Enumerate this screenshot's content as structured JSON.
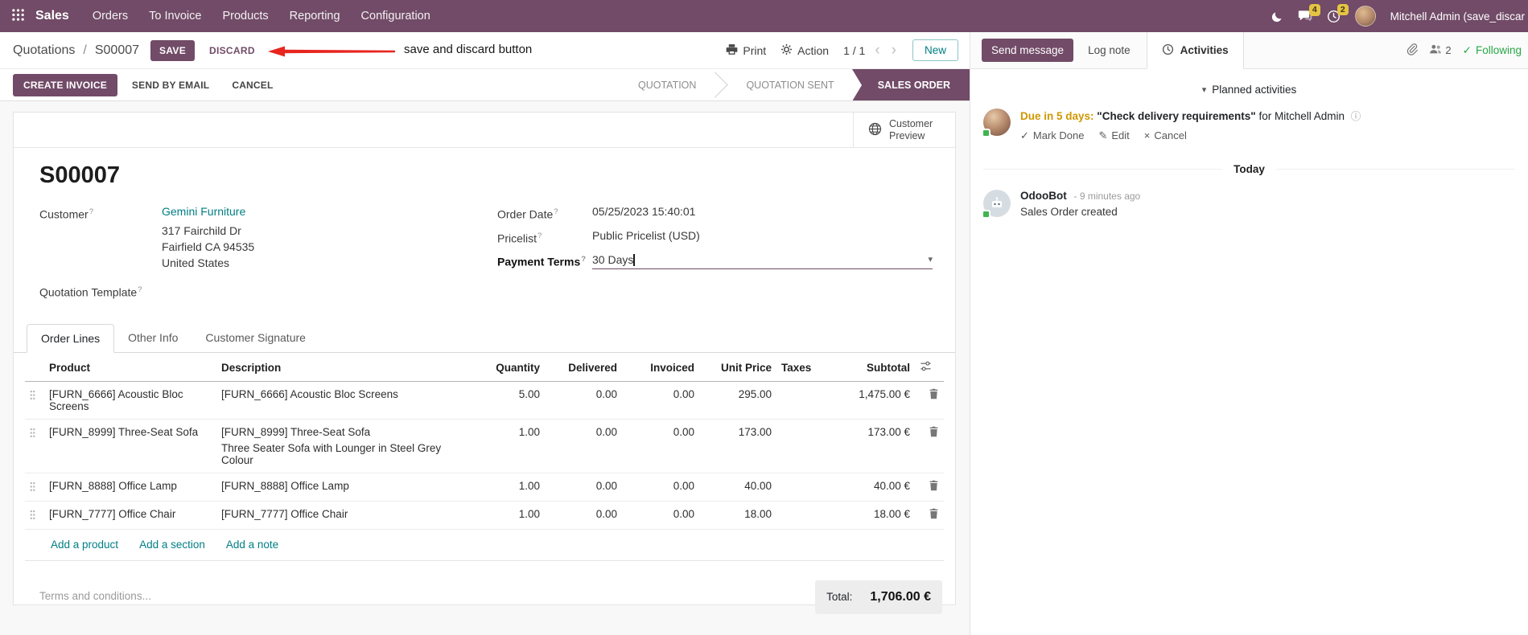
{
  "topbar": {
    "app_name": "Sales",
    "menus": [
      "Orders",
      "To Invoice",
      "Products",
      "Reporting",
      "Configuration"
    ],
    "messages_badge": "4",
    "activities_badge": "2",
    "user_name": "Mitchell Admin (save_discar"
  },
  "control_panel": {
    "breadcrumb_parent": "Quotations",
    "breadcrumb_sep": "/",
    "breadcrumb_current": "S00007",
    "save_label": "SAVE",
    "discard_label": "DISCARD",
    "annotation": "save and discard button",
    "print_label": "Print",
    "action_label": "Action",
    "pager": "1 / 1",
    "prev": "‹",
    "next": "›",
    "new_label": "New"
  },
  "statusbar": {
    "create_invoice": "CREATE INVOICE",
    "send_by_email": "SEND BY EMAIL",
    "cancel": "CANCEL",
    "steps": [
      "QUOTATION",
      "QUOTATION SENT",
      "SALES ORDER"
    ],
    "active_step": "SALES ORDER"
  },
  "sheet": {
    "preview_label": "Customer Preview",
    "title": "S00007",
    "help_marker": "?",
    "customer_label": "Customer",
    "customer_name": "Gemini Furniture",
    "address": [
      "317 Fairchild Dr",
      "Fairfield CA 94535",
      "United States"
    ],
    "quotation_template_label": "Quotation Template",
    "order_date_label": "Order Date",
    "order_date_value": "05/25/2023 15:40:01",
    "pricelist_label": "Pricelist",
    "pricelist_value": "Public Pricelist (USD)",
    "payment_terms_label": "Payment Terms",
    "payment_terms_value": "30 Days"
  },
  "tabs": [
    "Order Lines",
    "Other Info",
    "Customer Signature"
  ],
  "order_lines": {
    "headers": [
      "Product",
      "Description",
      "Quantity",
      "Delivered",
      "Invoiced",
      "Unit Price",
      "Taxes",
      "Subtotal"
    ],
    "rows": [
      {
        "product": "[FURN_6666] Acoustic Bloc Screens",
        "description": "[FURN_6666] Acoustic Bloc Screens",
        "description2": "",
        "quantity": "5.00",
        "delivered": "0.00",
        "invoiced": "0.00",
        "unit_price": "295.00",
        "taxes": "",
        "subtotal": "1,475.00 €"
      },
      {
        "product": "[FURN_8999] Three-Seat Sofa",
        "description": "[FURN_8999] Three-Seat Sofa",
        "description2": "Three Seater Sofa with Lounger in Steel Grey Colour",
        "quantity": "1.00",
        "delivered": "0.00",
        "invoiced": "0.00",
        "unit_price": "173.00",
        "taxes": "",
        "subtotal": "173.00 €"
      },
      {
        "product": "[FURN_8888] Office Lamp",
        "description": "[FURN_8888] Office Lamp",
        "description2": "",
        "quantity": "1.00",
        "delivered": "0.00",
        "invoiced": "0.00",
        "unit_price": "40.00",
        "taxes": "",
        "subtotal": "40.00 €"
      },
      {
        "product": "[FURN_7777] Office Chair",
        "description": "[FURN_7777] Office Chair",
        "description2": "",
        "quantity": "1.00",
        "delivered": "0.00",
        "invoiced": "0.00",
        "unit_price": "18.00",
        "taxes": "",
        "subtotal": "18.00 €"
      }
    ],
    "add_product": "Add a product",
    "add_section": "Add a section",
    "add_note": "Add a note",
    "terms_placeholder": "Terms and conditions...",
    "total_label": "Total:",
    "total_value": "1,706.00 €"
  },
  "chatter": {
    "send_message": "Send message",
    "log_note": "Log note",
    "activities_tab": "Activities",
    "followers_count": "2",
    "following": "Following",
    "planned_header": "Planned activities",
    "activity_due": "Due in 5 days:",
    "activity_summary": "\"Check delivery requirements\"",
    "activity_for": "for Mitchell Admin",
    "mark_done": "Mark Done",
    "edit": "Edit",
    "cancel": "Cancel",
    "date_divider": "Today",
    "msg_author": "OdooBot",
    "msg_time": "- 9 minutes ago",
    "msg_body": "Sales Order created"
  },
  "glyphs": {
    "caret_down": "▾",
    "check": "✓",
    "pencil": "✎",
    "cross": "×",
    "info": "ⓘ"
  },
  "colors": {
    "brand": "#714B67",
    "link": "#017E84",
    "modified": "#2d76c9",
    "warning": "#cf9700",
    "annotation": "#e8251f"
  }
}
